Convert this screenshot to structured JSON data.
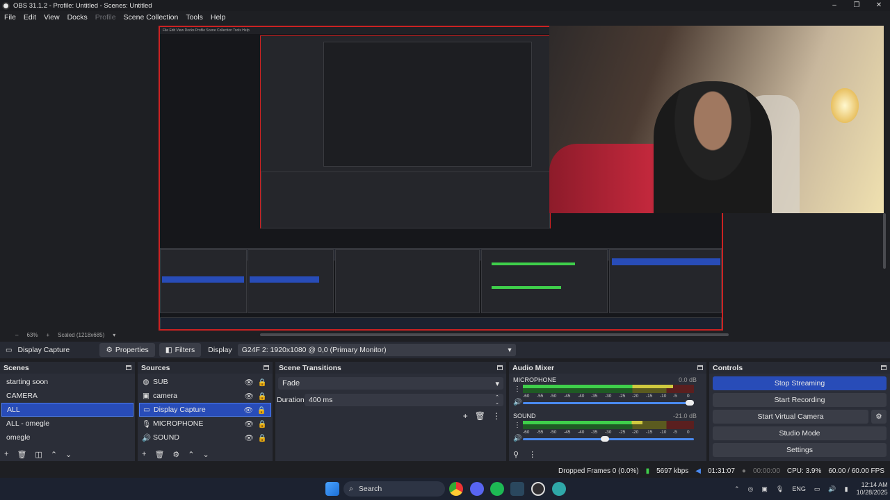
{
  "window": {
    "title": "OBS 31.1.2 - Profile: Untitled - Scenes: Untitled",
    "min": "–",
    "max": "❐",
    "close": "✕"
  },
  "menu": [
    "File",
    "Edit",
    "View",
    "Docks",
    "Profile",
    "Scene Collection",
    "Tools",
    "Help"
  ],
  "preview": {
    "zoom": "63%",
    "plus": "+",
    "scale": "Scaled (1218x685)",
    "caret": "▾"
  },
  "source_bar": {
    "name": "Display Capture",
    "properties": "Properties",
    "filters": "Filters",
    "display_label": "Display",
    "display_value": "G24F 2: 1920x1080 @ 0,0 (Primary Monitor)"
  },
  "scenes": {
    "title": "Scenes",
    "items": [
      "starting soon",
      "CAMERA",
      "ALL",
      "ALL - omegle",
      "omegle"
    ],
    "selected": 2
  },
  "sources": {
    "title": "Sources",
    "items": [
      {
        "name": "SUB",
        "icon": "globe-icon",
        "glyph": "◍"
      },
      {
        "name": "camera",
        "icon": "camera-icon",
        "glyph": "▣"
      },
      {
        "name": "Display Capture",
        "icon": "monitor-icon",
        "glyph": "▭"
      },
      {
        "name": "MICROPHONE",
        "icon": "microphone-icon",
        "glyph": "🎙"
      },
      {
        "name": "SOUND",
        "icon": "speaker-icon",
        "glyph": "🔊"
      }
    ],
    "selected": 2
  },
  "transitions": {
    "title": "Scene Transitions",
    "type": "Fade",
    "duration_label": "Duration",
    "duration_value": "400 ms"
  },
  "mixer": {
    "title": "Audio Mixer",
    "channels": [
      {
        "name": "MICROPHONE",
        "db": "0.0 dB",
        "level": 0.88,
        "volume": 1.0
      },
      {
        "name": "SOUND",
        "db": "-21.0 dB",
        "level": 0.7,
        "volume": 0.48
      }
    ],
    "ticks": [
      "-60",
      "-55",
      "-50",
      "-45",
      "-40",
      "-35",
      "-30",
      "-25",
      "-20",
      "-15",
      "-10",
      "-5",
      "0"
    ]
  },
  "controls": {
    "title": "Controls",
    "stop_streaming": "Stop Streaming",
    "start_recording": "Start Recording",
    "start_virtual_camera": "Start Virtual Camera",
    "studio_mode": "Studio Mode",
    "settings": "Settings"
  },
  "status": {
    "dropped": "Dropped Frames 0 (0.0%)",
    "bitrate": "5697 kbps",
    "live_time": "01:31:07",
    "rec_time": "00:00:00",
    "cpu": "CPU: 3.9%",
    "fps": "60.00 / 60.00 FPS"
  },
  "taskbar": {
    "search": "Search",
    "lang": "ENG",
    "time": "12:14 AM",
    "date": "10/28/2025"
  },
  "colors": {
    "accent": "#284cb8",
    "meter_green": "#3fcf4b",
    "meter_yellow": "#cfc93f",
    "meter_red": "#c93c3c",
    "recording_dot": "#e03030"
  }
}
